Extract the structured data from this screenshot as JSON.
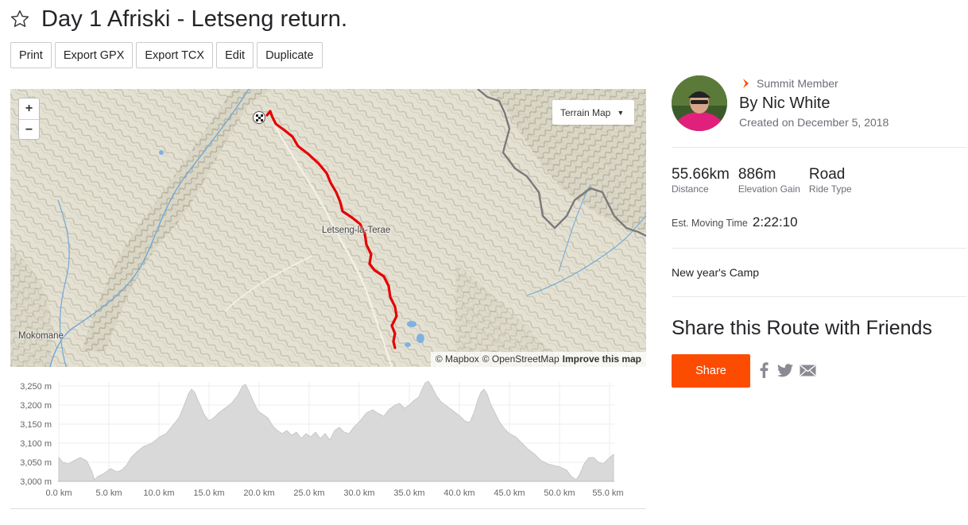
{
  "route": {
    "title": "Day 1 Afriski - Letseng return."
  },
  "toolbar": {
    "print": "Print",
    "export_gpx": "Export GPX",
    "export_tcx": "Export TCX",
    "edit": "Edit",
    "duplicate": "Duplicate"
  },
  "map": {
    "zoom_in": "+",
    "zoom_out": "−",
    "type_label": "Terrain Map",
    "place_labels": [
      "Letseng-la-Terae",
      "Mokomane"
    ],
    "attribution": {
      "mapbox": "© Mapbox",
      "osm": "© OpenStreetMap",
      "improve": "Improve this map"
    },
    "route_color": "#e60000",
    "border_color": "#7a7a7a"
  },
  "elevation": {
    "y_ticks": [
      "3,250 m",
      "3,200 m",
      "3,150 m",
      "3,100 m",
      "3,050 m",
      "3,000 m"
    ],
    "x_ticks": [
      "0.0 km",
      "5.0 km",
      "10.0 km",
      "15.0 km",
      "20.0 km",
      "25.0 km",
      "30.0 km",
      "35.0 km",
      "40.0 km",
      "45.0 km",
      "50.0 km",
      "55.0 km"
    ],
    "fill_color": "#d9d9d9"
  },
  "athlete": {
    "badge": "Summit Member",
    "name": "By Nic White",
    "created": "Created on December 5, 2018"
  },
  "stats": [
    {
      "value": "55.66km",
      "label": "Distance"
    },
    {
      "value": "886m",
      "label": "Elevation Gain"
    },
    {
      "value": "Road",
      "label": "Ride Type"
    }
  ],
  "moving_time": {
    "label": "Est. Moving Time",
    "value": "2:22:10"
  },
  "description": "New year's Camp",
  "share": {
    "heading": "Share this Route with Friends",
    "button": "Share",
    "accent": "#fc4c02"
  }
}
